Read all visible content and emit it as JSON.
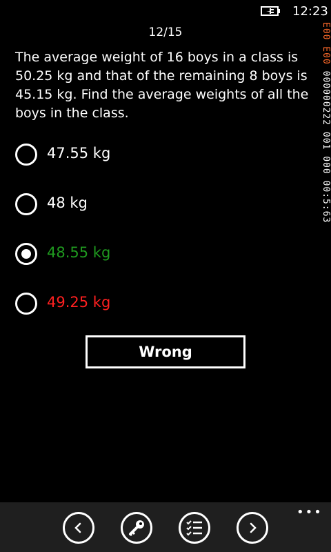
{
  "status": {
    "time": "12:23",
    "battery_icon": "battery-charging-icon"
  },
  "side_counter": {
    "orange_text": "E00 E00",
    "white_text": "000000222 001 000 00:5:63"
  },
  "quiz": {
    "progress": "12/15",
    "question": "The average weight of 16 boys in a class is 50.25 kg and that of the remaining 8 boys is 45.15 kg. Find the average weights of all the boys in the class.",
    "options": [
      {
        "label": "47.55 kg",
        "color": "#ffffff",
        "selected": false
      },
      {
        "label": "48 kg",
        "color": "#ffffff",
        "selected": false
      },
      {
        "label": "48.55 kg",
        "color": "#1f9a1f",
        "selected": true
      },
      {
        "label": "49.25 kg",
        "color": "#ff2020",
        "selected": false
      }
    ],
    "result_label": "Wrong"
  },
  "appbar": {
    "buttons": [
      "back-icon",
      "key-icon",
      "checklist-icon",
      "forward-icon"
    ],
    "more_label": "•••"
  }
}
